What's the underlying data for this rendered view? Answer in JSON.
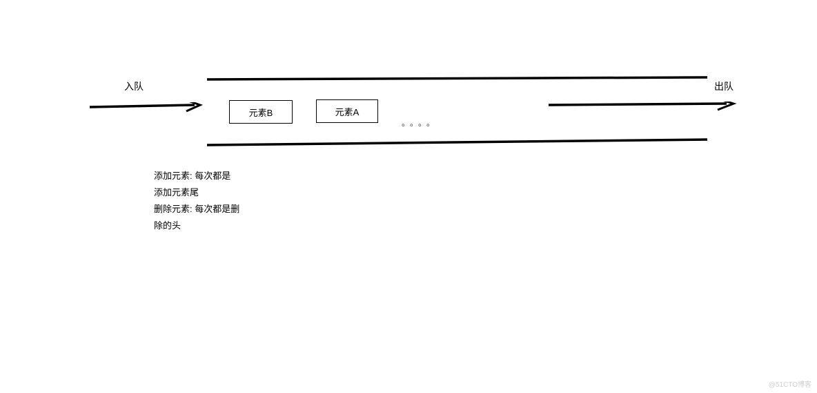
{
  "labels": {
    "enqueue": "入队",
    "dequeue": "出队"
  },
  "elements": {
    "b": "元素B",
    "a": "元素A",
    "ellipsis": "。。。。"
  },
  "description": {
    "line1": "添加元素:  每次都是",
    "line2": "添加元素尾",
    "line3": "删除元素:  每次都是删",
    "line4": "除的头"
  },
  "watermark": "@51CTO博客"
}
